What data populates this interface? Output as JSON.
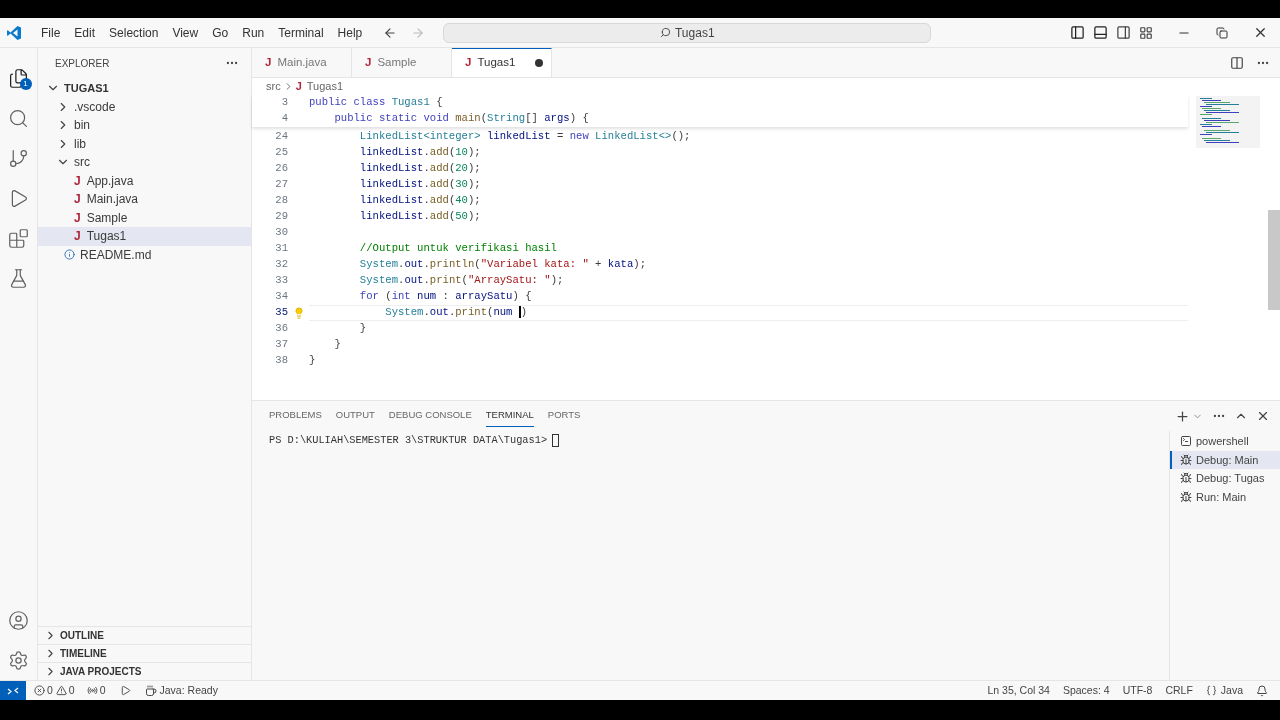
{
  "title_bar": {
    "menu": [
      "File",
      "Edit",
      "Selection",
      "View",
      "Go",
      "Run",
      "Terminal",
      "Help"
    ],
    "search": "Tugas1"
  },
  "activity_bar": {
    "top": [
      {
        "kind": "explorer",
        "selected": true,
        "badge": "1"
      },
      {
        "kind": "search",
        "selected": false
      },
      {
        "kind": "source-control",
        "selected": false
      },
      {
        "kind": "run-debug",
        "selected": false
      },
      {
        "kind": "extensions",
        "selected": false
      },
      {
        "kind": "testing",
        "selected": false
      }
    ],
    "bottom": [
      {
        "kind": "account"
      },
      {
        "kind": "settings"
      }
    ]
  },
  "sidebar": {
    "title": "EXPLORER",
    "tree": [
      {
        "label": "TUGAS1",
        "kind": "root",
        "expanded": true,
        "selected": false,
        "children": [
          {
            "label": ".vscode",
            "kind": "folder",
            "expanded": false,
            "selected": false
          },
          {
            "label": "bin",
            "kind": "folder",
            "expanded": false,
            "selected": false
          },
          {
            "label": "lib",
            "kind": "folder",
            "expanded": false,
            "selected": false
          },
          {
            "label": "src",
            "kind": "folder",
            "expanded": true,
            "selected": false,
            "children": [
              {
                "label": "App.java",
                "kind": "java",
                "icon": "J",
                "selected": false
              },
              {
                "label": "Main.java",
                "kind": "java",
                "icon": "J",
                "selected": false
              },
              {
                "label": "Sample",
                "kind": "java",
                "icon": "J",
                "selected": false
              },
              {
                "label": "Tugas1",
                "kind": "java",
                "icon": "J",
                "selected": true
              }
            ]
          },
          {
            "label": "README.md",
            "kind": "markdown",
            "selected": false
          }
        ]
      }
    ],
    "sections": [
      "OUTLINE",
      "TIMELINE",
      "JAVA PROJECTS"
    ]
  },
  "tabs": [
    {
      "label": "Main.java",
      "icon": "J",
      "selected": false,
      "dirty": false
    },
    {
      "label": "Sample",
      "icon": "J",
      "selected": false,
      "dirty": false
    },
    {
      "label": "Tugas1",
      "icon": "J",
      "selected": true,
      "dirty": true
    }
  ],
  "breadcrumb": {
    "folder": "src",
    "icon": "J",
    "file": "Tugas1"
  },
  "sticky_lines": [
    {
      "number": "3",
      "tokens": [
        {
          "text": "public class",
          "kind": "kw"
        },
        {
          "text": " Tugas1",
          "kind": "type"
        },
        {
          "text": " {",
          "kind": "plain"
        }
      ]
    },
    {
      "number": "4",
      "tokens": [
        {
          "text": "    public static void",
          "kind": "kw"
        },
        {
          "text": " main",
          "kind": "fn"
        },
        {
          "text": "(",
          "kind": "plain"
        },
        {
          "text": "String",
          "kind": "type"
        },
        {
          "text": "[] ",
          "kind": "plain"
        },
        {
          "text": "args",
          "kind": "var"
        },
        {
          "text": ") {",
          "kind": "plain"
        }
      ]
    }
  ],
  "code_lines": [
    {
      "number": "24",
      "current": false,
      "tokens": [
        {
          "text": "        LinkedList<integer>",
          "kind": "type"
        },
        {
          "text": " linkedList",
          "kind": "var"
        },
        {
          "text": " = ",
          "kind": "plain"
        },
        {
          "text": "new",
          "kind": "kw"
        },
        {
          "text": " LinkedList<>",
          "kind": "type"
        },
        {
          "text": "();",
          "kind": "plain"
        }
      ]
    },
    {
      "number": "25",
      "current": false,
      "tokens": [
        {
          "text": "        linkedList",
          "kind": "var"
        },
        {
          "text": ".",
          "kind": "plain"
        },
        {
          "text": "add",
          "kind": "fn"
        },
        {
          "text": "(",
          "kind": "plain"
        },
        {
          "text": "10",
          "kind": "num"
        },
        {
          "text": ");",
          "kind": "plain"
        }
      ]
    },
    {
      "number": "26",
      "current": false,
      "tokens": [
        {
          "text": "        linkedList",
          "kind": "var"
        },
        {
          "text": ".",
          "kind": "plain"
        },
        {
          "text": "add",
          "kind": "fn"
        },
        {
          "text": "(",
          "kind": "plain"
        },
        {
          "text": "20",
          "kind": "num"
        },
        {
          "text": ");",
          "kind": "plain"
        }
      ]
    },
    {
      "number": "27",
      "current": false,
      "tokens": [
        {
          "text": "        linkedList",
          "kind": "var"
        },
        {
          "text": ".",
          "kind": "plain"
        },
        {
          "text": "add",
          "kind": "fn"
        },
        {
          "text": "(",
          "kind": "plain"
        },
        {
          "text": "30",
          "kind": "num"
        },
        {
          "text": ");",
          "kind": "plain"
        }
      ]
    },
    {
      "number": "28",
      "current": false,
      "tokens": [
        {
          "text": "        linkedList",
          "kind": "var"
        },
        {
          "text": ".",
          "kind": "plain"
        },
        {
          "text": "add",
          "kind": "fn"
        },
        {
          "text": "(",
          "kind": "plain"
        },
        {
          "text": "40",
          "kind": "num"
        },
        {
          "text": ");",
          "kind": "plain"
        }
      ]
    },
    {
      "number": "29",
      "current": false,
      "tokens": [
        {
          "text": "        linkedList",
          "kind": "var"
        },
        {
          "text": ".",
          "kind": "plain"
        },
        {
          "text": "add",
          "kind": "fn"
        },
        {
          "text": "(",
          "kind": "plain"
        },
        {
          "text": "50",
          "kind": "num"
        },
        {
          "text": ");",
          "kind": "plain"
        }
      ]
    },
    {
      "number": "30",
      "current": false
    },
    {
      "number": "31",
      "current": false,
      "tokens": [
        {
          "text": "        //Output untuk verifikasi hasil",
          "kind": "comment"
        }
      ]
    },
    {
      "number": "32",
      "current": false,
      "tokens": [
        {
          "text": "        System",
          "kind": "type"
        },
        {
          "text": ".",
          "kind": "plain"
        },
        {
          "text": "out",
          "kind": "var"
        },
        {
          "text": ".",
          "kind": "plain"
        },
        {
          "text": "println",
          "kind": "fn"
        },
        {
          "text": "(",
          "kind": "plain"
        },
        {
          "text": "\"Variabel kata: \"",
          "kind": "str"
        },
        {
          "text": " + ",
          "kind": "plain"
        },
        {
          "text": "kata",
          "kind": "var"
        },
        {
          "text": ");",
          "kind": "plain"
        }
      ]
    },
    {
      "number": "33",
      "current": false,
      "tokens": [
        {
          "text": "        System",
          "kind": "type"
        },
        {
          "text": ".",
          "kind": "plain"
        },
        {
          "text": "out",
          "kind": "var"
        },
        {
          "text": ".",
          "kind": "plain"
        },
        {
          "text": "print",
          "kind": "fn"
        },
        {
          "text": "(",
          "kind": "plain"
        },
        {
          "text": "\"ArraySatu: \"",
          "kind": "str"
        },
        {
          "text": ");",
          "kind": "plain"
        }
      ]
    },
    {
      "number": "34",
      "current": false,
      "tokens": [
        {
          "text": "        for",
          "kind": "kw"
        },
        {
          "text": " (",
          "kind": "plain"
        },
        {
          "text": "int",
          "kind": "kw"
        },
        {
          "text": " num",
          "kind": "var"
        },
        {
          "text": " : ",
          "kind": "plain"
        },
        {
          "text": "arraySatu",
          "kind": "var"
        },
        {
          "text": ") {",
          "kind": "plain"
        }
      ]
    },
    {
      "number": "35",
      "current": true,
      "tokens": [
        {
          "text": "            System",
          "kind": "type"
        },
        {
          "text": ".",
          "kind": "plain"
        },
        {
          "text": "out",
          "kind": "var"
        },
        {
          "text": ".",
          "kind": "plain"
        },
        {
          "text": "print",
          "kind": "fn"
        },
        {
          "text": "(",
          "kind": "plain"
        },
        {
          "text": "num ",
          "kind": "var"
        },
        {
          "text": ")",
          "kind": "plain"
        }
      ]
    },
    {
      "number": "36",
      "current": false,
      "tokens": [
        {
          "text": "        }",
          "kind": "plain"
        }
      ]
    },
    {
      "number": "37",
      "current": false,
      "tokens": [
        {
          "text": "    }",
          "kind": "plain"
        }
      ]
    },
    {
      "number": "38",
      "current": false,
      "tokens": [
        {
          "text": "}",
          "kind": "plain"
        }
      ]
    }
  ],
  "panel": {
    "tabs": [
      {
        "label": "PROBLEMS",
        "selected": false
      },
      {
        "label": "OUTPUT",
        "selected": false
      },
      {
        "label": "DEBUG CONSOLE",
        "selected": false
      },
      {
        "label": "TERMINAL",
        "selected": true
      },
      {
        "label": "PORTS",
        "selected": false
      }
    ],
    "terminal_prompt": "PS D:\\KULIAH\\SEMESTER 3\\STRUKTUR DATA\\Tugas1>",
    "terminals": [
      {
        "label": "powershell",
        "kind": "shell",
        "selected": false
      },
      {
        "label": "Debug: Main",
        "kind": "debug",
        "selected": true
      },
      {
        "label": "Debug: Tugas",
        "kind": "debug",
        "selected": false
      },
      {
        "label": "Run: Main",
        "kind": "debug",
        "selected": false
      }
    ]
  },
  "status_bar": {
    "errors": "0",
    "warnings": "0",
    "ports": "0",
    "java_status": "Java: Ready",
    "position": "Ln 35, Col 34",
    "indent": "Spaces: 4",
    "encoding": "UTF-8",
    "eol": "CRLF",
    "language": "Java"
  }
}
